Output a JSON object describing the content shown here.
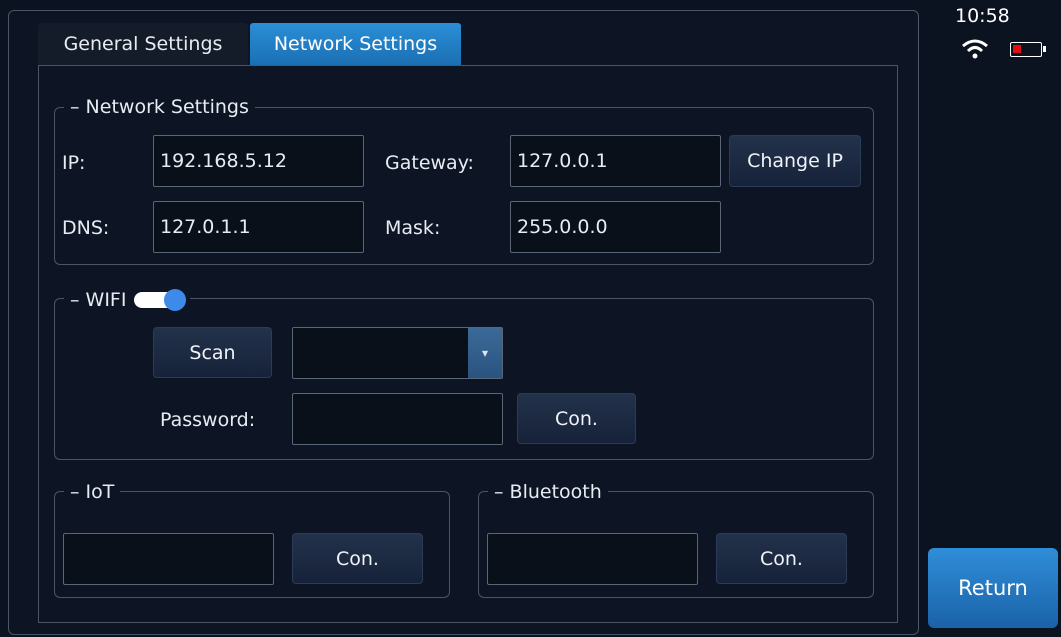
{
  "status": {
    "time": "10:58",
    "wifi_icon": "wifi-icon",
    "battery_icon": "battery-icon",
    "battery_color": "#e01010"
  },
  "tabs": [
    {
      "label": "General Settings",
      "active": false
    },
    {
      "label": "Network Settings",
      "active": true
    }
  ],
  "network": {
    "legend": "Network Settings",
    "ip_label": "IP:",
    "ip_value": "192.168.5.12",
    "gateway_label": "Gateway:",
    "gateway_value": "127.0.0.1",
    "change_ip_label": "Change IP",
    "dns_label": "DNS:",
    "dns_value": "127.0.1.1",
    "mask_label": "Mask:",
    "mask_value": "255.0.0.0"
  },
  "wifi": {
    "legend": "WIFI",
    "enabled": true,
    "scan_label": "Scan",
    "network_select_value": "",
    "password_label": "Password:",
    "password_value": "",
    "connect_label": "Con."
  },
  "iot": {
    "legend": "IoT",
    "value": "",
    "connect_label": "Con."
  },
  "bluetooth": {
    "legend": "Bluetooth",
    "value": "",
    "connect_label": "Con."
  },
  "return_label": "Return",
  "colors": {
    "accent": "#2b8fd6",
    "background": "#0b1220",
    "toggle_knob": "#3d8ae8"
  }
}
